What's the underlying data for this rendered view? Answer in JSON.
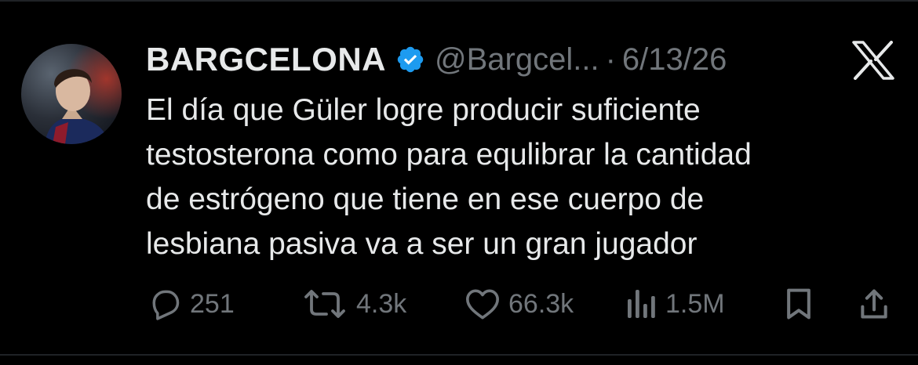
{
  "tweet": {
    "display_name": "BARGCELONA",
    "handle": "@Bargcel...",
    "separator": "·",
    "date": "6/13/26",
    "text_lines": [
      "El día que Güler logre producir suficiente",
      "testosterona como para equlibrar la cantidad",
      "de estrógeno que tiene en ese cuerpo de",
      "lesbiana pasiva va a ser un gran jugador"
    ],
    "verified_color": "#1d9bf0",
    "icons": {
      "platform": "x-logo-icon",
      "verified": "verified-badge-icon"
    }
  },
  "actions": {
    "reply": {
      "icon": "reply-icon",
      "count": "251"
    },
    "retweet": {
      "icon": "retweet-icon",
      "count": "4.3k"
    },
    "like": {
      "icon": "heart-icon",
      "count": "66.3k"
    },
    "views": {
      "icon": "views-icon",
      "count": "1.5M"
    },
    "bookmark": {
      "icon": "bookmark-icon"
    },
    "share": {
      "icon": "share-icon"
    }
  },
  "colors": {
    "background": "#000000",
    "text": "#e7e9ea",
    "muted": "#71767b",
    "accent": "#1d9bf0"
  }
}
